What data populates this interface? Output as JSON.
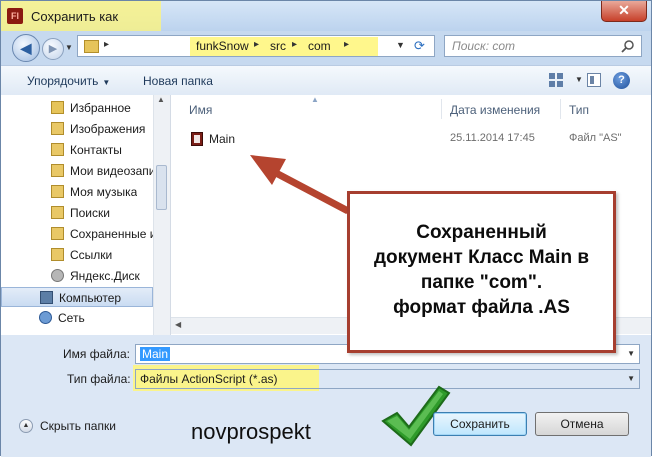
{
  "window": {
    "title": "Сохранить как",
    "app_icon": "Fl",
    "close_glyph": "✕"
  },
  "navigation": {
    "path": [
      "funkSnow",
      "src",
      "com"
    ],
    "search_placeholder": "Поиск: com"
  },
  "toolbar": {
    "organize_label": "Упорядочить",
    "new_folder_label": "Новая папка"
  },
  "nav_pane": {
    "items": [
      {
        "label": "Избранное",
        "icon": "star-folder-icon"
      },
      {
        "label": "Изображения",
        "icon": "folder-icon"
      },
      {
        "label": "Контакты",
        "icon": "folder-icon"
      },
      {
        "label": "Мои видеозапи",
        "icon": "folder-icon"
      },
      {
        "label": "Моя музыка",
        "icon": "folder-icon"
      },
      {
        "label": "Поиски",
        "icon": "folder-icon"
      },
      {
        "label": "Сохраненные и",
        "icon": "folder-icon"
      },
      {
        "label": "Ссылки",
        "icon": "folder-icon"
      },
      {
        "label": "Яндекс.Диск",
        "icon": "disk-icon"
      },
      {
        "label": "Компьютер",
        "icon": "computer-icon"
      },
      {
        "label": "Сеть",
        "icon": "network-icon"
      }
    ],
    "selected": "Компьютер"
  },
  "file_list": {
    "columns": [
      "Имя",
      "Дата изменения",
      "Тип"
    ],
    "rows": [
      {
        "name": "Main",
        "date": "25.11.2014 17:45",
        "type": "Файл \"AS\""
      }
    ]
  },
  "form": {
    "filename_label": "Имя файла:",
    "filename_value": "Main",
    "filetype_label": "Тип файла:",
    "filetype_value": "Файлы ActionScript (*.as)"
  },
  "footer": {
    "hide_folders_label": "Скрыть папки",
    "save_button": "Сохранить",
    "cancel_button": "Отмена"
  },
  "annotation": {
    "lines": [
      "Сохраненный",
      "документ Класс Main в",
      "папке \"com\".",
      "формат файла .AS"
    ],
    "watermark": "novprospekt",
    "colors": {
      "callout_border": "#a63e2f",
      "highlight": "#fff678",
      "check": "#2e9b2a"
    }
  }
}
